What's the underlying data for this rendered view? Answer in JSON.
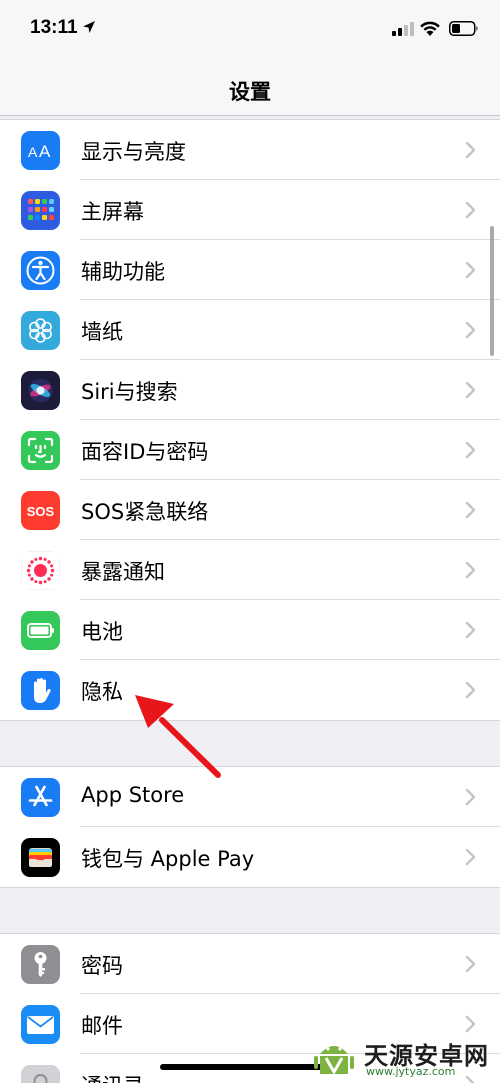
{
  "status_bar": {
    "time": "13:11"
  },
  "nav": {
    "title": "设置"
  },
  "groups": [
    {
      "rows": [
        {
          "label": "显示与亮度",
          "icon": "display-brightness-icon"
        },
        {
          "label": "主屏幕",
          "icon": "home-screen-icon"
        },
        {
          "label": "辅助功能",
          "icon": "accessibility-icon"
        },
        {
          "label": "墙纸",
          "icon": "wallpaper-icon"
        },
        {
          "label": "Siri与搜索",
          "icon": "siri-icon"
        },
        {
          "label": "面容ID与密码",
          "icon": "face-id-icon"
        },
        {
          "label": "SOS紧急联络",
          "icon": "sos-icon",
          "icon_text": "SOS"
        },
        {
          "label": "暴露通知",
          "icon": "exposure-notification-icon"
        },
        {
          "label": "电池",
          "icon": "battery-icon"
        },
        {
          "label": "隐私",
          "icon": "privacy-hand-icon"
        }
      ]
    },
    {
      "rows": [
        {
          "label": "App Store",
          "icon": "app-store-icon"
        },
        {
          "label": "钱包与 Apple Pay",
          "icon": "wallet-icon"
        }
      ]
    },
    {
      "rows": [
        {
          "label": "密码",
          "icon": "passwords-key-icon"
        },
        {
          "label": "邮件",
          "icon": "mail-icon"
        },
        {
          "label": "通讯录",
          "icon": "contacts-icon"
        }
      ]
    }
  ],
  "icon_colors": {
    "display": "#1a7cf5",
    "home": "#2f5be0",
    "accessibility": "#1a7cf5",
    "wallpaper": "#34aadc",
    "siri": "#1c1c3a",
    "face_id": "#34c759",
    "sos": "#ff3b30",
    "exposure": "#ffffff",
    "battery": "#34c759",
    "privacy": "#1a7cf5",
    "app_store": "#1a7cf5",
    "wallet": "#000000",
    "passwords": "#8e8e93",
    "mail": "#1a8cf5",
    "contacts": "#c7c7cc"
  },
  "annotation": {
    "color": "#e8161b"
  },
  "watermark": {
    "title": "天源安卓网",
    "url": "www.jytyaz.com"
  }
}
